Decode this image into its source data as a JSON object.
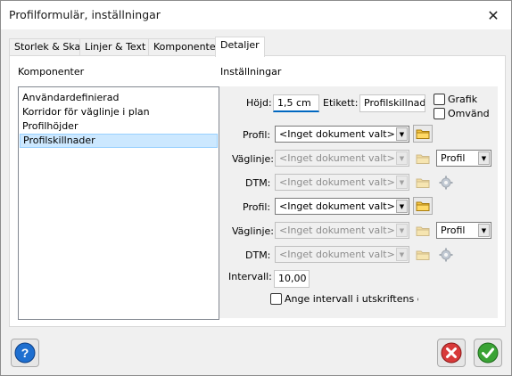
{
  "window": {
    "title": "Profilformulär, inställningar"
  },
  "tabs": [
    {
      "label": "Storlek & Skala"
    },
    {
      "label": "Linjer & Text"
    },
    {
      "label": "Komponenter"
    },
    {
      "label": "Detaljer"
    }
  ],
  "left": {
    "title": "Komponenter",
    "items": [
      {
        "label": "Användardefinierad"
      },
      {
        "label": "Korridor för väglinje i plan"
      },
      {
        "label": "Profilhöjder"
      },
      {
        "label": "Profilskillnader"
      }
    ],
    "selected": "Profilskillnader"
  },
  "settings": {
    "title": "Inställningar",
    "hojd_label": "Höjd:",
    "hojd_value": "1,5 cm",
    "etikett_label": "Etikett:",
    "etikett_value": "Profilskillnader",
    "grafik_label": "Grafik",
    "omvand_label": "Omvänd",
    "profil_label": "Profil:",
    "vaglinje_label": "Väglinje:",
    "dtm_label": "DTM:",
    "no_doc": "<Inget dokument valt>",
    "profil_option": "Profil",
    "intervall_label": "Intervall:",
    "intervall_value": "10,00",
    "ange_label": "Ange intervall i utskriftens enh"
  },
  "colors": {
    "selected_bg": "#cce8ff",
    "help_icon": "#1e6fd0",
    "cancel_icon": "#d83a3a",
    "ok_icon": "#3aa335"
  },
  "icons": [
    "close-icon",
    "folder-icon",
    "gear-icon",
    "help-icon",
    "cancel-icon",
    "ok-icon"
  ]
}
